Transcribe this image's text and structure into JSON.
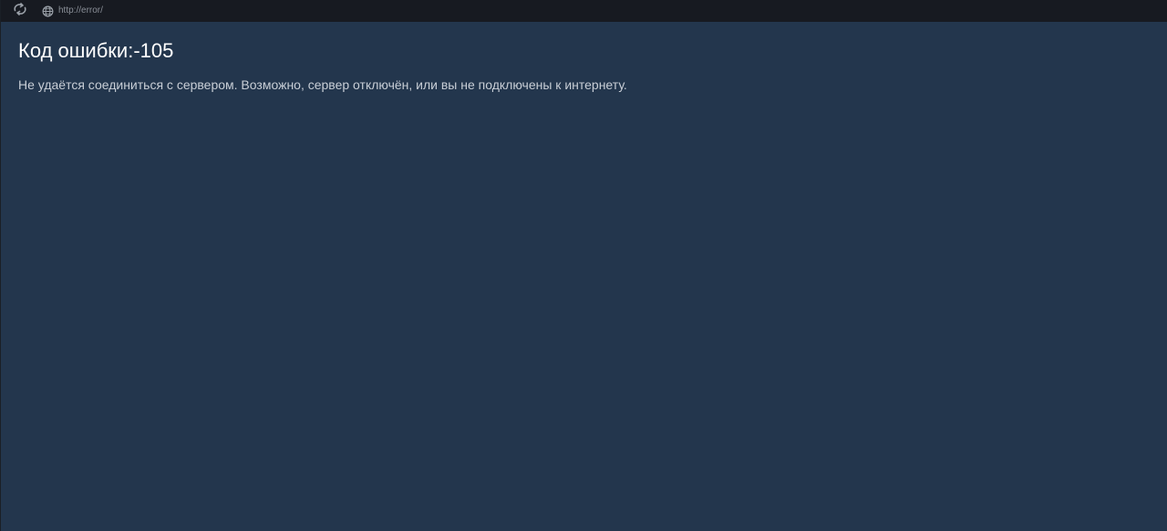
{
  "toolbar": {
    "reload_icon": "reload-icon",
    "globe_icon": "globe-icon",
    "url": "http://error/"
  },
  "error": {
    "title": "Код ошибки:-105",
    "message": "Не удаётся соединиться с сервером. Возможно, сервер отключён, или вы не подключены к интернету."
  },
  "colors": {
    "background": "#23364d",
    "topbar": "#171a21",
    "title_text": "#ffffff",
    "message_text": "#c8ced6"
  }
}
